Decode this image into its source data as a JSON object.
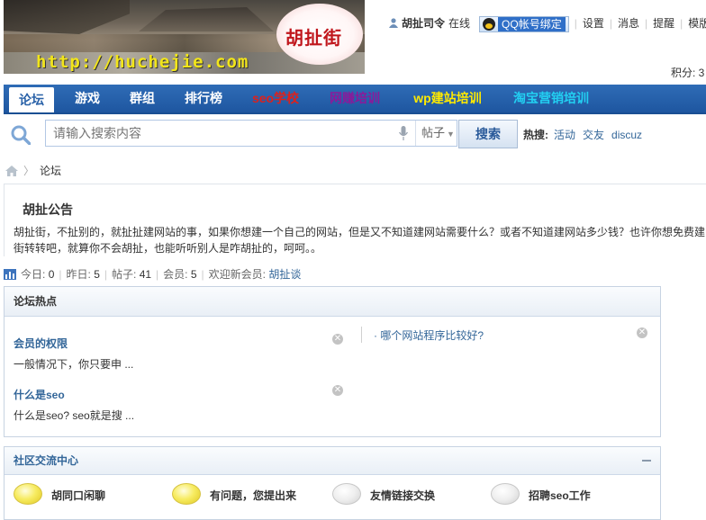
{
  "header": {
    "logo_text": "胡扯街",
    "logo_url": "http://huchejie.com",
    "username": "胡扯司令",
    "online_status": "在线",
    "qq_bind": "QQ帐号绑定",
    "links": [
      "设置",
      "消息",
      "提醒",
      "模版"
    ],
    "points": "积分: 3"
  },
  "nav": {
    "items": [
      {
        "label": "论坛",
        "color": "#2a62a8"
      },
      {
        "label": "游戏",
        "color": "#ffffff"
      },
      {
        "label": "群组",
        "color": "#ffffff"
      },
      {
        "label": "排行榜",
        "color": "#ffffff"
      },
      {
        "label": "seo学校",
        "color": "#e0201a"
      },
      {
        "label": "网赚培训",
        "color": "#8b1a9a"
      },
      {
        "label": "wp建站培训",
        "color": "#ffea00"
      },
      {
        "label": "淘宝营销培训",
        "color": "#22d0f2"
      }
    ]
  },
  "search": {
    "placeholder": "请输入搜索内容",
    "type": "帖子",
    "button": "搜索",
    "hot_label": "热搜:",
    "hot_terms": [
      "活动",
      "交友",
      "discuz"
    ]
  },
  "breadcrumb": {
    "current": "论坛"
  },
  "announcement": {
    "title": "胡扯公告",
    "text_line1": "胡扯街，不扯别的，就扯扯建网站的事，如果你想建一个自己的网站，但是又不知道建网站需要什么？或者不知道建网站多少钱？也许你想免费建",
    "text_line2": "街转转吧，就算你不会胡扯，也能听听别人是咋胡扯的，呵呵。。"
  },
  "stats": {
    "today_label": "今日:",
    "today": "0",
    "yesterday_label": "昨日:",
    "yesterday": "5",
    "posts_label": "帖子:",
    "posts": "41",
    "members_label": "会员:",
    "members": "5",
    "welcome_label": "欢迎新会员:",
    "new_member": "胡扯谈"
  },
  "hot_topics": {
    "title": "论坛热点",
    "items": [
      {
        "title": "会员的权限",
        "excerpt": "一般情况下，你只要申 ..."
      },
      {
        "title": "什么是seo",
        "excerpt": "什么是seo? seo就是搜 ..."
      }
    ],
    "side_link": "· 哪个网站程序比较好?"
  },
  "community": {
    "title": "社区交流中心",
    "forums": [
      {
        "name": "胡同口闲聊",
        "state": "on"
      },
      {
        "name": "有问题，您提出来",
        "state": "on"
      },
      {
        "name": "友情链接交换",
        "state": "off"
      },
      {
        "name": "招聘seo工作",
        "state": "off"
      }
    ]
  }
}
